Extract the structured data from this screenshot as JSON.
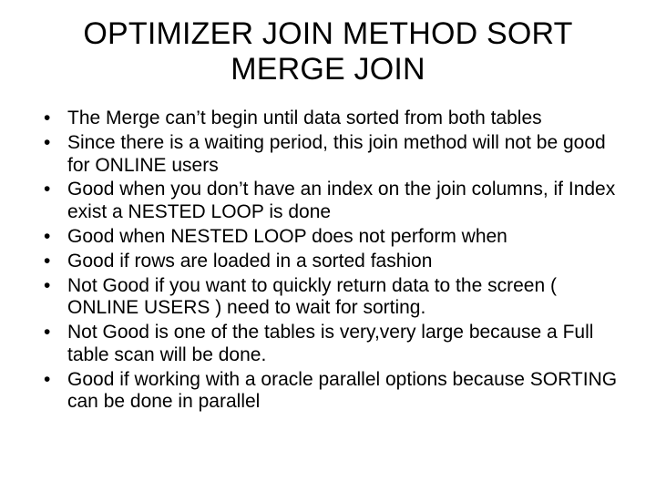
{
  "title": "OPTIMIZER JOIN METHOD SORT MERGE JOIN",
  "bullets": [
    "The Merge can’t begin until data sorted from both tables",
    "Since there is a waiting period, this join method will not be good for ONLINE users",
    "Good when you don’t have an index on the join columns, if Index exist a NESTED LOOP is done",
    "Good when NESTED LOOP does not perform when",
    "Good if rows are loaded in a sorted fashion",
    "Not Good if you want to quickly return data to the screen ( ONLINE USERS ) need to wait for sorting.",
    "Not Good is one of the tables is very,very large because a Full table scan will be done.",
    "Good if working with a oracle parallel options because SORTING can be done in parallel"
  ]
}
